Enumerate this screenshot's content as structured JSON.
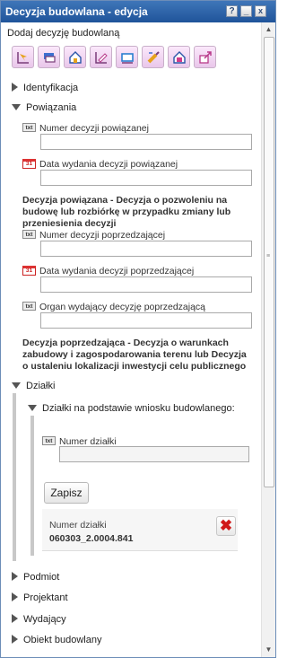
{
  "window": {
    "title": "Decyzja budowlana - edycja",
    "help": "?",
    "minimize": "_",
    "close": "x"
  },
  "add_label": "Dodaj decyzję budowlaną",
  "toolbar": {
    "icons": [
      "select-icon",
      "layer-icon",
      "house-edit-icon",
      "edit-pencil-icon",
      "rectangle-icon",
      "brush-icon",
      "house-delete-icon",
      "export-icon"
    ]
  },
  "sections": {
    "identyfikacja": "Identyfikacja",
    "powiazania": "Powiązania",
    "dzialki": "Działki",
    "podmiot": "Podmiot",
    "projektant": "Projektant",
    "wydajacy": "Wydający",
    "obiekt": "Obiekt budowlany"
  },
  "powiazania": {
    "badge_txt": "txt",
    "badge_cal": "31",
    "numer_decyzji_powiazanej": {
      "label": "Numer decyzji powiązanej",
      "value": ""
    },
    "data_wydania_powiazanej": {
      "label": "Data wydania decyzji powiązanej",
      "value": ""
    },
    "note1": "Decyzja powiązana - Decyzja o pozwoleniu na budowę lub rozbiórkę w przypadku zmiany lub przeniesienia decyzji",
    "numer_decyzji_poprzedzajacej": {
      "label": "Numer decyzji poprzedzającej",
      "value": ""
    },
    "data_wydania_poprzedzajacej": {
      "label": "Data wydania decyzji poprzedzającej",
      "value": ""
    },
    "organ_wydajacy": {
      "label": "Organ wydający decyzję poprzedzającą",
      "value": ""
    },
    "note2": "Decyzja poprzedzająca - Decyzja o warunkach zabudowy i zagospodarowania terenu lub Decyzja o ustaleniu lokalizacji inwestycji celu publicznego"
  },
  "dzialki": {
    "subsection": "Działki na podstawie wniosku budowlanego:",
    "numer_dzialki_label": "Numer działki",
    "numer_dzialki_value": "",
    "save_button": "Zapisz",
    "records": [
      {
        "label": "Numer działki",
        "value": "060303_2.0004.841"
      }
    ],
    "delete_icon": "delete-x-icon"
  },
  "colors": {
    "title_bar": "#2b63a8",
    "toolbar_icon_bg": "#f2d7f2",
    "delete": "#d01818"
  }
}
